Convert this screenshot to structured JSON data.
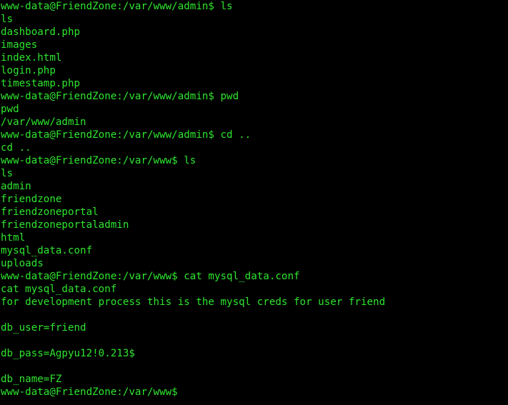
{
  "terminal": {
    "text_color": "#2ee52e",
    "background": "#000000",
    "lines": [
      "www-data@FriendZone:/var/www/admin$ ls",
      "ls",
      "dashboard.php",
      "images",
      "index.html",
      "login.php",
      "timestamp.php",
      "www-data@FriendZone:/var/www/admin$ pwd",
      "pwd",
      "/var/www/admin",
      "www-data@FriendZone:/var/www/admin$ cd ..",
      "cd ..",
      "www-data@FriendZone:/var/www$ ls",
      "ls",
      "admin",
      "friendzone",
      "friendzoneportal",
      "friendzoneportaladmin",
      "html",
      "mysql_data.conf",
      "uploads",
      "www-data@FriendZone:/var/www$ cat mysql_data.conf",
      "cat mysql_data.conf",
      "for development process this is the mysql creds for user friend",
      "",
      "db_user=friend",
      "",
      "db_pass=Agpyu12!0.213$",
      "",
      "db_name=FZ",
      "www-data@FriendZone:/var/www$"
    ]
  }
}
